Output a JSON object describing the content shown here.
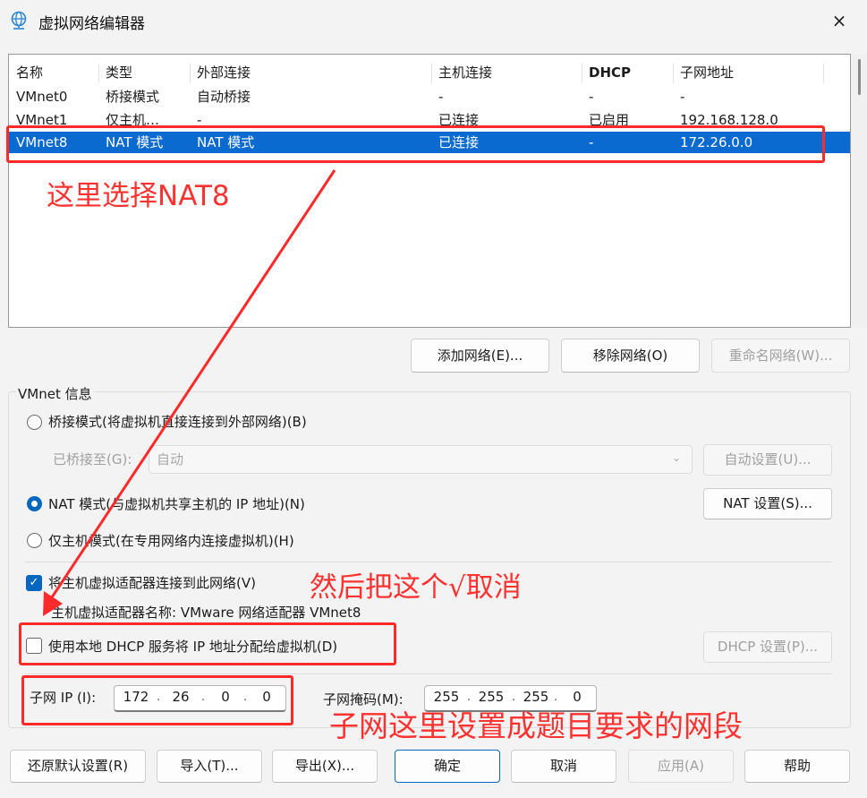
{
  "window": {
    "title": "虚拟网络编辑器",
    "close": "×"
  },
  "columns": [
    "名称",
    "类型",
    "外部连接",
    "主机连接",
    "DHCP",
    "子网地址"
  ],
  "rows": [
    [
      "VMnet0",
      "桥接模式",
      "自动桥接",
      "-",
      "-",
      "-"
    ],
    [
      "VMnet1",
      "仅主机…",
      "-",
      "已连接",
      "已启用",
      "192.168.128.0"
    ],
    [
      "VMnet8",
      "NAT 模式",
      "NAT 模式",
      "已连接",
      "-",
      "172.26.0.0"
    ]
  ],
  "list_buttons": {
    "add": "添加网络(E)...",
    "remove": "移除网络(O)",
    "rename": "重命名网络(W)..."
  },
  "info": {
    "group_title": "VMnet 信息",
    "bridged_label": "桥接模式(将虚拟机直接连接到外部网络)(B)",
    "bridged_to_label": "已桥接至(G):",
    "bridged_to_value": "自动",
    "auto_settings": "自动设置(U)...",
    "nat_label": "NAT 模式(与虚拟机共享主机的 IP 地址)(N)",
    "nat_settings": "NAT 设置(S)...",
    "hostonly_label": "仅主机模式(在专用网络内连接虚拟机)(H)",
    "connect_adapter_label": "将主机虚拟适配器连接到此网络(V)",
    "adapter_name_label": "主机虚拟适配器名称: VMware 网络适配器 VMnet8",
    "dhcp_label": "使用本地 DHCP 服务将 IP 地址分配给虚拟机(D)",
    "dhcp_settings": "DHCP 设置(P)...",
    "subnet_ip_label": "子网 IP (I):",
    "subnet_ip": [
      "172",
      "26",
      "0",
      "0"
    ],
    "subnet_mask_label": "子网掩码(M):",
    "subnet_mask": [
      "255",
      "255",
      "255",
      "0"
    ]
  },
  "bottom_buttons": {
    "restore": "还原默认设置(R)",
    "import": "导入(T)...",
    "export": "导出(X)...",
    "ok": "确定",
    "cancel": "取消",
    "apply": "应用(A)",
    "help": "帮助"
  },
  "annotations": {
    "select_nat": "这里选择NAT8",
    "uncheck": "然后把这个√取消",
    "subnet": "子网这里设置成题目要求的网段"
  },
  "colors": {
    "annotation": "#ff2a2a",
    "selection": "#0a6ad0",
    "accent": "#0067c0"
  },
  "state": {
    "selected_row": "VMnet8",
    "mode": "nat",
    "connect_adapter": true,
    "use_dhcp": false
  }
}
